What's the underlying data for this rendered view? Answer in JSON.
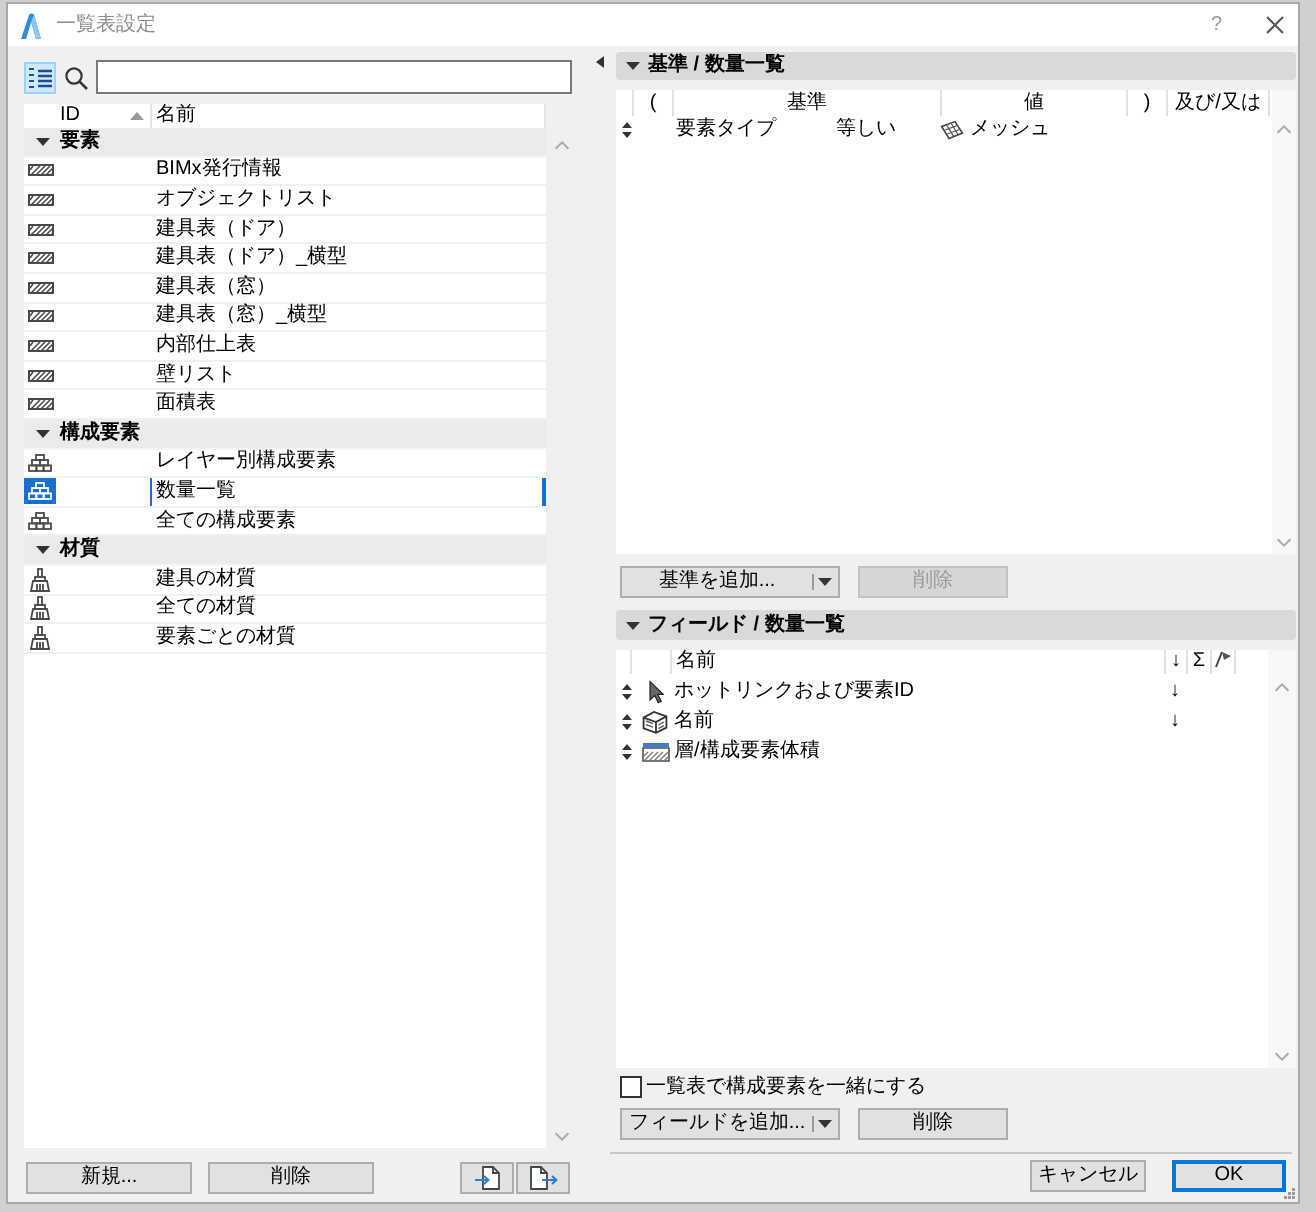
{
  "window": {
    "title": "一覧表設定",
    "help": "?"
  },
  "list": {
    "view_button": {
      "selected": true
    },
    "columns": [
      {
        "label": "ID",
        "sorted": true
      },
      {
        "label": "名前",
        "sorted": false
      }
    ],
    "groups": [
      {
        "label": "要素",
        "kind": "element",
        "expanded": true,
        "children": [
          {
            "name": "BIMx発行情報",
            "selected": false
          },
          {
            "name": "オブジェクトリスト",
            "selected": false
          },
          {
            "name": "建具表（ドア）",
            "selected": false
          },
          {
            "name": "建具表（ドア）_横型",
            "selected": false
          },
          {
            "name": "建具表（窓）",
            "selected": false
          },
          {
            "name": "建具表（窓）_横型",
            "selected": false
          },
          {
            "name": "内部仕上表",
            "selected": false
          },
          {
            "name": "壁リスト",
            "selected": false
          },
          {
            "name": "面積表",
            "selected": false
          }
        ]
      },
      {
        "label": "構成要素",
        "kind": "component",
        "expanded": true,
        "children": [
          {
            "name": "レイヤー別構成要素",
            "selected": false
          },
          {
            "name": "数量一覧",
            "selected": true
          },
          {
            "name": "全ての構成要素",
            "selected": false
          }
        ]
      },
      {
        "label": "材質",
        "kind": "material",
        "expanded": true,
        "children": [
          {
            "name": "建具の材質",
            "selected": false
          },
          {
            "name": "全ての材質",
            "selected": false
          },
          {
            "name": "要素ごとの材質",
            "selected": false
          }
        ]
      }
    ],
    "new_button": "新規...",
    "delete_button": "削除"
  },
  "criteria": {
    "title": "基準 / 数量一覧",
    "expanded": true,
    "columns": [
      "(",
      "基準",
      "値",
      ")",
      "及び/又は"
    ],
    "rows": [
      {
        "criterion": "要素タイプ",
        "operator": "等しい",
        "value": "メッシュ"
      }
    ],
    "add_button": "基準を追加...",
    "delete_button": {
      "label": "削除",
      "disabled": true
    }
  },
  "fields": {
    "title": "フィールド / 数量一覧",
    "expanded": true,
    "columns": {
      "name": "名前",
      "sort": "↓",
      "sum": "Σ"
    },
    "rows": [
      {
        "kind": "pointer",
        "name": "ホットリンクおよび要素ID",
        "sort": "↓"
      },
      {
        "kind": "object",
        "name": "名前",
        "sort": "↓"
      },
      {
        "kind": "layers",
        "name": "層/構成要素体積"
      }
    ],
    "option": {
      "label": "一覧表で構成要素を一緒にする",
      "checked": false
    },
    "add_button": "フィールドを追加...",
    "delete_button": {
      "label": "削除",
      "disabled": false
    }
  },
  "footer": {
    "cancel": "キャンセル",
    "ok": "OK"
  }
}
